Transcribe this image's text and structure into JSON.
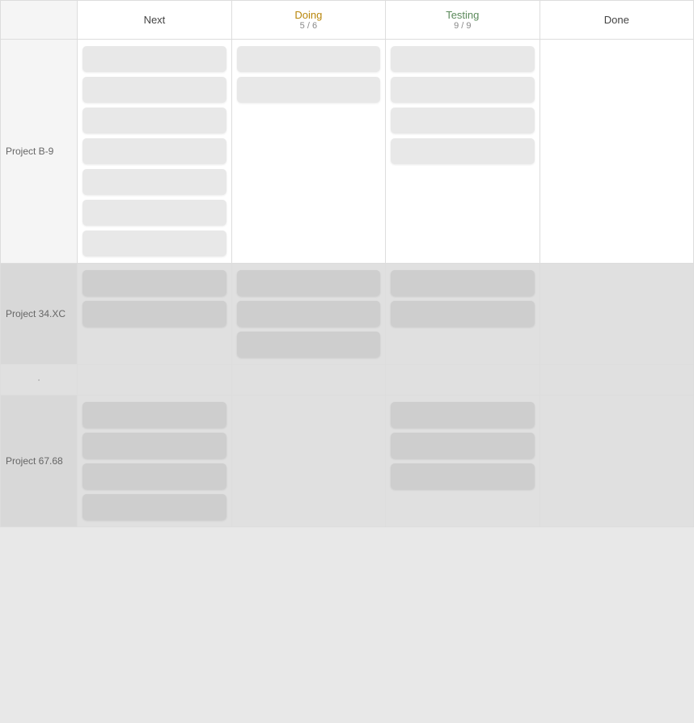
{
  "columns": {
    "label": "",
    "next": "Next",
    "doing": "Doing",
    "doing_count": "5 / 6",
    "testing": "Testing",
    "testing_count": "9 / 9",
    "done": "Done"
  },
  "projects": [
    {
      "name": "Project B-9",
      "theme": "light",
      "next_cards": 7,
      "doing_cards": 2,
      "testing_cards": 4,
      "done_cards": 0
    },
    {
      "name": "Project 34.XC",
      "theme": "dark",
      "next_cards": 2,
      "doing_cards": 3,
      "testing_cards": 2,
      "done_cards": 0
    },
    {
      "name": "",
      "theme": "dark",
      "next_cards": 0,
      "doing_cards": 0,
      "testing_cards": 0,
      "done_cards": 0,
      "dot": true
    },
    {
      "name": "Project 67.68",
      "theme": "dark",
      "next_cards": 4,
      "doing_cards": 0,
      "testing_cards": 3,
      "done_cards": 0
    }
  ]
}
